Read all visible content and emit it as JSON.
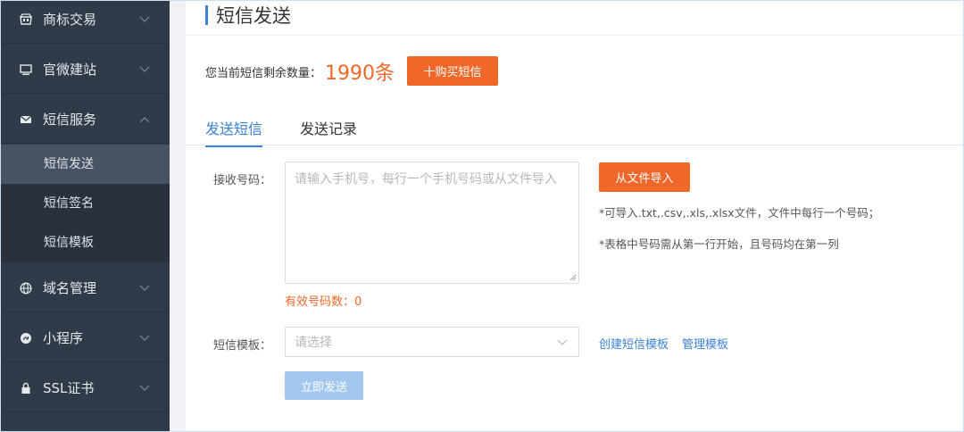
{
  "sidebar": {
    "items": [
      {
        "label": "商标交易",
        "icon": "store-icon"
      },
      {
        "label": "官微建站",
        "icon": "monitor-icon"
      },
      {
        "label": "短信服务",
        "icon": "mail-icon"
      },
      {
        "label": "域名管理",
        "icon": "globe-icon"
      },
      {
        "label": "小程序",
        "icon": "mini-program-icon"
      },
      {
        "label": "SSL证书",
        "icon": "lock-icon"
      }
    ],
    "submenu": [
      {
        "label": "短信发送",
        "active": true
      },
      {
        "label": "短信签名",
        "active": false
      },
      {
        "label": "短信模板",
        "active": false
      }
    ]
  },
  "main": {
    "title": "短信发送",
    "quota_label": "您当前短信剩余数量：",
    "quota_count": "1990条",
    "buy_button": "十购买短信",
    "tabs": [
      {
        "label": "发送短信",
        "active": true
      },
      {
        "label": "发送记录",
        "active": false
      }
    ],
    "recipient_label": "接收号码：",
    "recipient_placeholder": "请输入手机号，每行一个手机号码或从文件导入",
    "import_button": "从文件导入",
    "hint_1": "*可导入.txt,.csv,.xls,.xlsx文件，文件中每行一个号码；",
    "hint_2": "*表格中号码需从第一行开始，且号码均在第一列",
    "valid_count": "有效号码数：0",
    "template_label": "短信模板：",
    "template_placeholder": "请选择",
    "create_template_link": "创建短信模板",
    "manage_template_link": "管理模板",
    "send_button": "立即发送"
  },
  "colors": {
    "sidebar_bg": "#313a49",
    "accent_blue": "#3b82d6",
    "accent_orange": "#f0672a",
    "send_disabled": "#a3c7ef"
  }
}
